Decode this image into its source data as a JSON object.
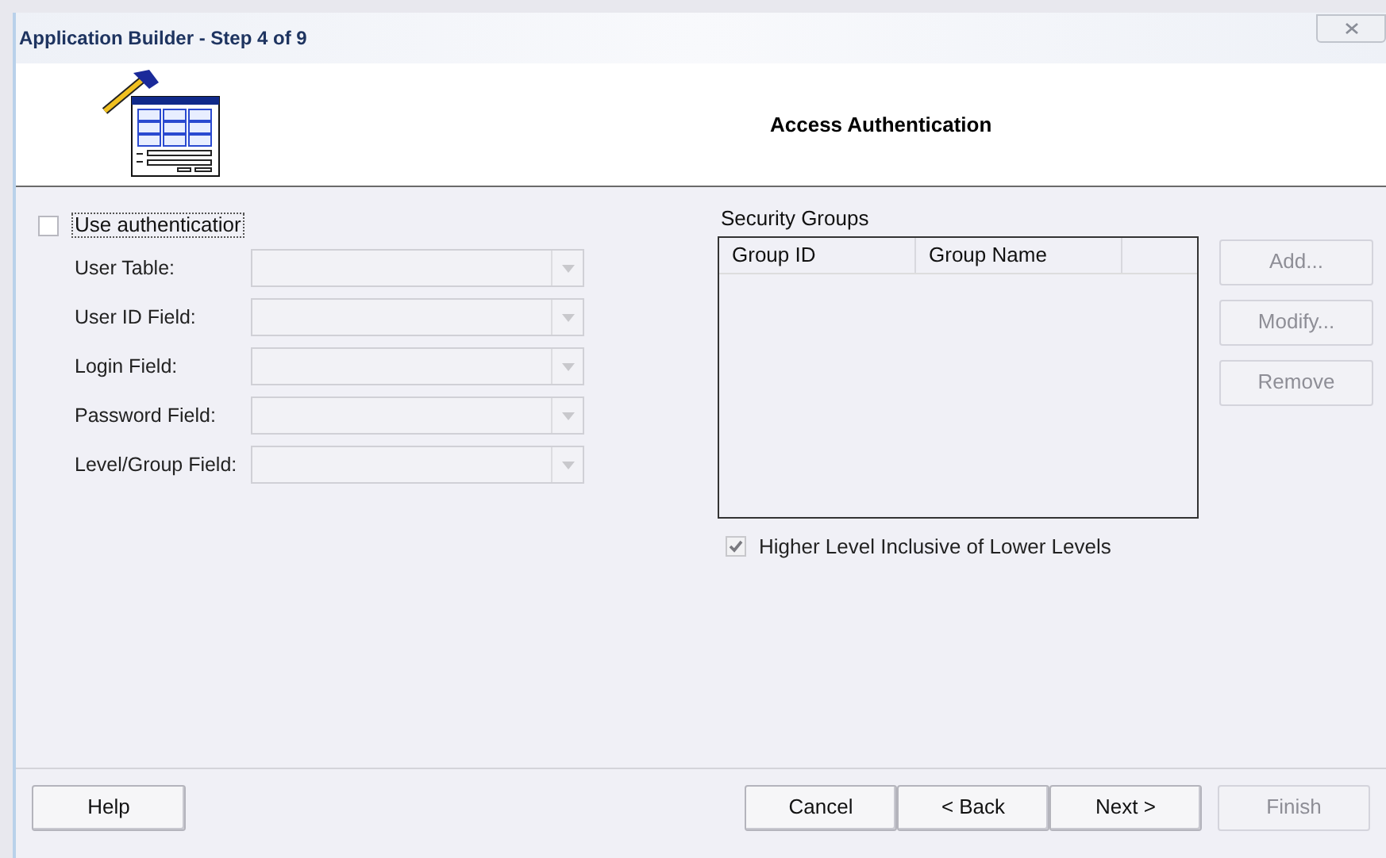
{
  "window": {
    "title": "Application Builder - Step 4 of 9"
  },
  "header": {
    "title": "Access Authentication"
  },
  "use_authentication": {
    "label": "Use authenticatior",
    "checked": false,
    "disabled": false
  },
  "fields": [
    {
      "label": "User Table:",
      "disabled": true
    },
    {
      "label": "User ID Field:",
      "disabled": true
    },
    {
      "label": "Login Field:",
      "disabled": true
    },
    {
      "label": "Password Field:",
      "disabled": true
    },
    {
      "label": "Level/Group Field:",
      "disabled": true
    }
  ],
  "security_groups": {
    "label": "Security Groups",
    "columns": [
      "Group ID",
      "Group Name"
    ],
    "buttons": [
      {
        "label": "Add...",
        "disabled": true
      },
      {
        "label": "Modify...",
        "disabled": true
      },
      {
        "label": "Remove",
        "disabled": true
      }
    ],
    "inclusive": {
      "label": "Higher Level Inclusive of Lower Levels",
      "checked": true,
      "disabled": true
    }
  },
  "footer": {
    "help": {
      "label": "Help",
      "disabled": false
    },
    "buttons": [
      {
        "label": "Cancel",
        "disabled": false
      },
      {
        "label": "< Back",
        "disabled": false
      },
      {
        "label": "Next >",
        "disabled": false
      },
      {
        "label": "Finish",
        "disabled": true
      }
    ]
  }
}
